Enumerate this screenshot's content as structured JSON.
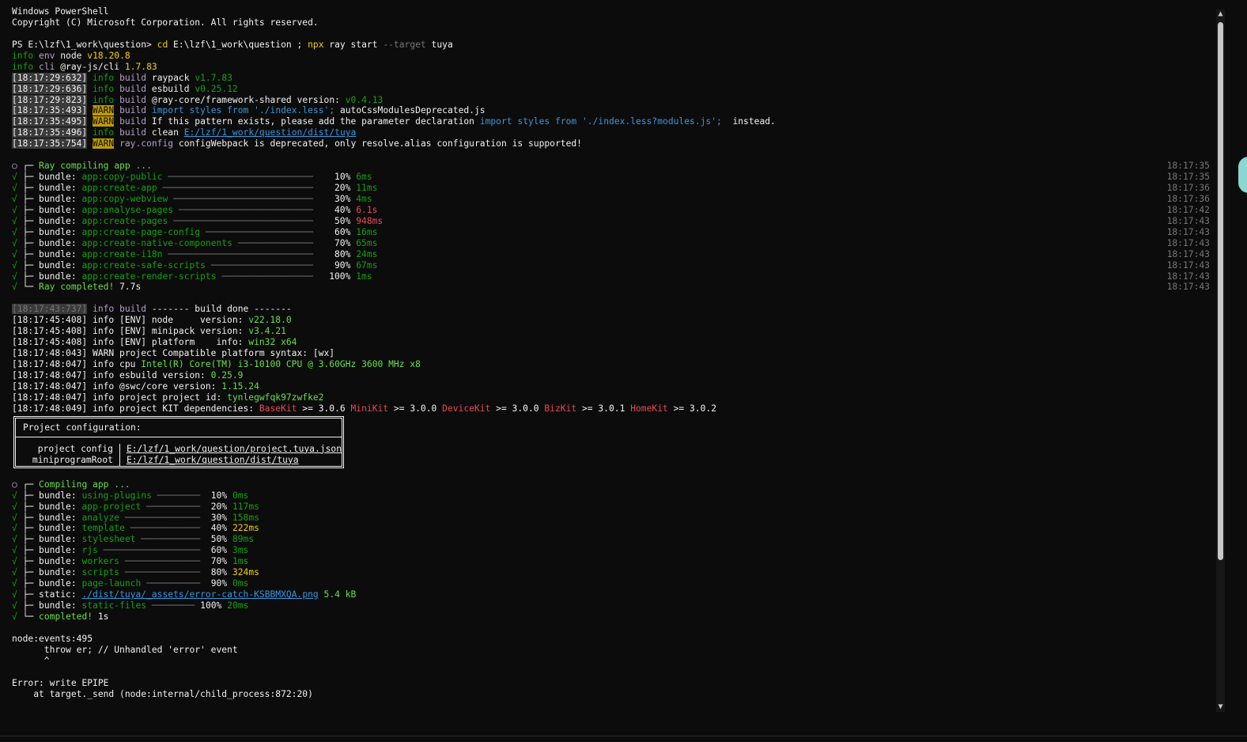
{
  "header": {
    "title": "Windows PowerShell",
    "copyright": "Copyright (C) Microsoft Corporation. All rights reserved."
  },
  "command": {
    "prompt": "PS E:\\lzf\\1_work\\question> ",
    "cd": "cd",
    "path": " E:\\lzf\\1_work\\question ; ",
    "npx": "npx",
    "args": " ray start ",
    "flag": "--target",
    "target": " tuya"
  },
  "env": [
    {
      "label": "info",
      "key": "env",
      "name": "node",
      "version": "v18.20.8"
    },
    {
      "label": "info",
      "key": "cli",
      "name": "@ray-js/cli",
      "version": "1.7.83"
    }
  ],
  "build_logs": [
    {
      "ts": "[18:17:29:632]",
      "level": "info",
      "cat": "build",
      "text": "raypack",
      "extra": "v1.7.83"
    },
    {
      "ts": "[18:17:29:636]",
      "level": "info",
      "cat": "build",
      "text": "esbuild",
      "extra": "v0.25.12"
    },
    {
      "ts": "[18:17:29:823]",
      "level": "info",
      "cat": "build",
      "text": "@ray-core/framework-shared version:",
      "extra": "v0.4.13"
    }
  ],
  "warn_logs": {
    "w1": {
      "ts": "[18:17:35:493]",
      "level": "WARN",
      "cat": "build",
      "code": "import styles from './index.less';",
      "text": " autoCssModulesDeprecated.js"
    },
    "w2": {
      "ts": "[18:17:35:495]",
      "level": "WARN",
      "cat": "build",
      "text": "If this pattern exists, please add the parameter declaration",
      "code": "import styles from './index.less?modules.js';",
      "tail": "  instead."
    },
    "clean": {
      "ts": "[18:17:35:496]",
      "level": "info",
      "cat": "build",
      "text": "clean",
      "path": "E:/lzf/1_work/question/dist/tuya"
    },
    "w3": {
      "ts": "[18:17:35:754]",
      "level": "WARN",
      "cat": "ray.config",
      "text": "configWebpack is deprecated, only resolve.alias configuration is supported!"
    }
  },
  "ray_compile": {
    "header": "Ray compiling app ...",
    "header_time": "18:17:35",
    "tasks": [
      {
        "name": "app:copy-public",
        "pct": "10%",
        "dur": "6ms",
        "warn": false,
        "time": "18:17:35"
      },
      {
        "name": "app:create-app",
        "pct": "20%",
        "dur": "11ms",
        "warn": false,
        "time": "18:17:36"
      },
      {
        "name": "app:copy-webview",
        "pct": "30%",
        "dur": "4ms",
        "warn": false,
        "time": "18:17:36"
      },
      {
        "name": "app:analyse-pages",
        "pct": "40%",
        "dur": "6.1s",
        "warn": true,
        "time": "18:17:42"
      },
      {
        "name": "app:create-pages",
        "pct": "50%",
        "dur": "948ms",
        "warn": true,
        "time": "18:17:43"
      },
      {
        "name": "app:create-page-config",
        "pct": "60%",
        "dur": "16ms",
        "warn": false,
        "time": "18:17:43"
      },
      {
        "name": "app:create-native-components",
        "pct": "70%",
        "dur": "65ms",
        "warn": false,
        "time": "18:17:43"
      },
      {
        "name": "app:create-i18n",
        "pct": "80%",
        "dur": "24ms",
        "warn": false,
        "time": "18:17:43"
      },
      {
        "name": "app:create-safe-scripts",
        "pct": "90%",
        "dur": "67ms",
        "warn": false,
        "time": "18:17:43"
      },
      {
        "name": "app:create-render-scripts",
        "pct": "100%",
        "dur": "1ms",
        "warn": false,
        "time": "18:17:43"
      }
    ],
    "done_label": "Ray completed!",
    "done_time": "7.7s",
    "done_ts": "18:17:43",
    "bundle_label": "bundle:"
  },
  "info_logs": {
    "done": {
      "ts": "[18:17:43:737]",
      "level": "info",
      "cat": "build",
      "text": "------- build done -------"
    },
    "lines": [
      {
        "ts": "[18:17:45:408]",
        "text": " info [ENV] node     version: ",
        "val": "v22.18.0"
      },
      {
        "ts": "[18:17:45:408]",
        "text": " info [ENV] minipack version: ",
        "val": "v3.4.21"
      },
      {
        "ts": "[18:17:45:408]",
        "text": " info [ENV] platform    info: ",
        "val": "win32 x64"
      },
      {
        "ts": "[18:17:48:043]",
        "text": " WARN project Compatible platform syntax: [wx]",
        "val": ""
      },
      {
        "ts": "[18:17:48:047]",
        "text": " info cpu ",
        "val": "Intel(R) Core(TM) i3-10100 CPU @ 3.60GHz 3600 MHz x8"
      },
      {
        "ts": "[18:17:48:047]",
        "text": " info esbuild version: ",
        "val": "0.25.9"
      },
      {
        "ts": "[18:17:48:047]",
        "text": " info @swc/core version: ",
        "val": "1.15.24"
      },
      {
        "ts": "[18:17:48:047]",
        "text": " info project project id: ",
        "val": "tynlegwfqk97zwfke2"
      }
    ],
    "kit": {
      "ts": "[18:17:48:049]",
      "text": " info project KIT dependencies: ",
      "items": [
        {
          "name": "BaseKit",
          "ver": " >= 3.0.6 "
        },
        {
          "name": "MiniKit",
          "ver": " >= 3.0.0 "
        },
        {
          "name": "DeviceKit",
          "ver": " >= 3.0.0 "
        },
        {
          "name": "BizKit",
          "ver": " >= 3.0.1 "
        },
        {
          "name": "HomeKit",
          "ver": " >= 3.0.2"
        }
      ]
    }
  },
  "project_config": {
    "title": "Project configuration:",
    "rows": [
      {
        "key": "project config",
        "value": "E:/lzf/1_work/question/project.tuya.json"
      },
      {
        "key": "miniprogramRoot",
        "value": "E:/lzf/1_work/question/dist/tuya"
      }
    ]
  },
  "mini_compile": {
    "header": "Compiling app ...",
    "tasks": [
      {
        "kind": "bundle:",
        "name": "using-plugins",
        "pct": "10%",
        "dur": "0ms",
        "warn": false
      },
      {
        "kind": "bundle:",
        "name": "app-project",
        "pct": "20%",
        "dur": "117ms",
        "warn": false
      },
      {
        "kind": "bundle:",
        "name": "analyze",
        "pct": "30%",
        "dur": "158ms",
        "warn": false
      },
      {
        "kind": "bundle:",
        "name": "template",
        "pct": "40%",
        "dur": "222ms",
        "warn": true
      },
      {
        "kind": "bundle:",
        "name": "stylesheet",
        "pct": "50%",
        "dur": "89ms",
        "warn": false
      },
      {
        "kind": "bundle:",
        "name": "rjs",
        "pct": "60%",
        "dur": "3ms",
        "warn": false
      },
      {
        "kind": "bundle:",
        "name": "workers",
        "pct": "70%",
        "dur": "1ms",
        "warn": false
      },
      {
        "kind": "bundle:",
        "name": "scripts",
        "pct": "80%",
        "dur": "324ms",
        "warn": true
      },
      {
        "kind": "bundle:",
        "name": "page-launch",
        "pct": "90%",
        "dur": "0ms",
        "warn": false
      }
    ],
    "static": {
      "kind": "static:",
      "path": "./dist/tuya/_assets/error-catch-KSBBMXQA.png",
      "size": "5.4 kB"
    },
    "final": {
      "kind": "bundle:",
      "name": "static-files",
      "pct": "100%",
      "dur": "20ms"
    },
    "done_label": "completed!",
    "done_time": "1s"
  },
  "error": {
    "l1": "node:events:495",
    "l2": "      throw er; // Unhandled 'error' event",
    "l3": "      ^",
    "l4": "Error: write EPIPE",
    "l5": "    at target._send (node:internal/child_process:872:20)"
  },
  "glyphs": {
    "check": "√",
    "ring": "○",
    "tee": "├─",
    "end": "└─",
    "top": "┌─",
    "up": "▲",
    "down": "▼"
  },
  "colors": {
    "background": "#0c0c0c",
    "foreground": "#cccccc",
    "green": "#13a10e",
    "light_green": "#6adf4a",
    "warn_bg": "#c19c00",
    "red": "#e74856",
    "blue": "#3a96dd"
  }
}
